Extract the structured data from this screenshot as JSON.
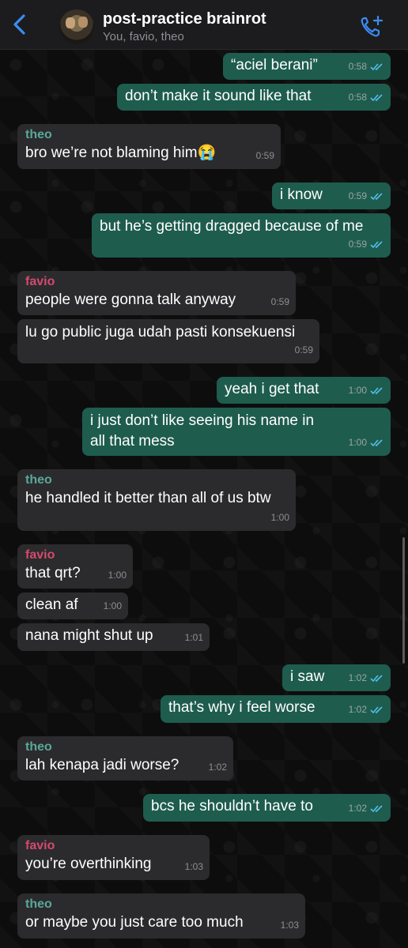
{
  "header": {
    "title": "post-practice brainrot",
    "subtitle": "You, favio, theo",
    "back_icon": "chevron-left-icon",
    "call_icon": "add-call-icon"
  },
  "colors": {
    "outgoing": "#1e5c4e",
    "incoming": "#2b2b2d",
    "theo": "#5aa89a",
    "favio": "#d44a6e",
    "read_tick": "#53bdeb"
  },
  "messages": [
    {
      "dir": "out",
      "text": "“aciel berani”",
      "time": "0:58"
    },
    {
      "dir": "out",
      "text": "don’t make it sound like that",
      "time": "0:58"
    },
    {
      "dir": "in",
      "sender": "theo",
      "text": "bro we’re not blaming him😭",
      "time": "0:59"
    },
    {
      "dir": "out",
      "text": "i know",
      "time": "0:59"
    },
    {
      "dir": "out",
      "text": "but he’s getting dragged because of me",
      "time": "0:59"
    },
    {
      "dir": "in",
      "sender": "favio",
      "text": "people were gonna talk anyway",
      "time": "0:59"
    },
    {
      "dir": "in",
      "text": "lu go public juga udah pasti konsekuensi",
      "time": "0:59"
    },
    {
      "dir": "out",
      "text": "yeah i get that",
      "time": "1:00"
    },
    {
      "dir": "out",
      "text": "i just don’t like seeing his name in all that mess",
      "time": "1:00"
    },
    {
      "dir": "in",
      "sender": "theo",
      "text": "he handled it better than all of us btw",
      "time": "1:00"
    },
    {
      "dir": "in",
      "sender": "favio",
      "text": "that qrt?",
      "time": "1:00"
    },
    {
      "dir": "in",
      "text": "clean af",
      "time": "1:00"
    },
    {
      "dir": "in",
      "text": "nana might shut up",
      "time": "1:01"
    },
    {
      "dir": "out",
      "text": "i saw",
      "time": "1:02"
    },
    {
      "dir": "out",
      "text": "that’s why i feel worse",
      "time": "1:02"
    },
    {
      "dir": "in",
      "sender": "theo",
      "text": "lah kenapa jadi worse?",
      "time": "1:02"
    },
    {
      "dir": "out",
      "text": "bcs he shouldn’t have to",
      "time": "1:02"
    },
    {
      "dir": "in",
      "sender": "favio",
      "text": "you’re overthinking",
      "time": "1:03"
    },
    {
      "dir": "in",
      "sender": "theo",
      "text": "or maybe you just care too much",
      "time": "1:03"
    }
  ]
}
